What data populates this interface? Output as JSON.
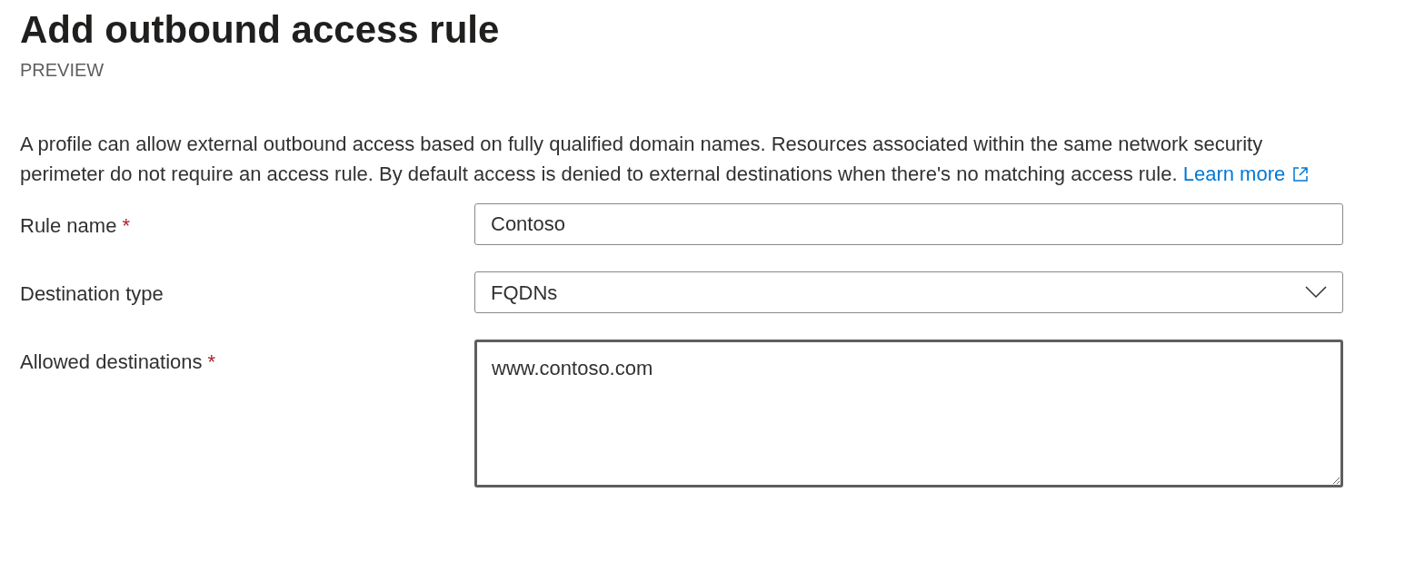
{
  "title": "Add outbound access rule",
  "subtitle": "PREVIEW",
  "description": {
    "text": "A profile can allow external outbound access based on fully qualified domain names. Resources associated within the same network security perimeter do not require an access rule. By default access is denied to external destinations when there's no matching access rule.",
    "link": "Learn more"
  },
  "fields": [
    {
      "kind": "text",
      "label": "Rule name",
      "required_mark": "*",
      "value": "Contoso",
      "focused": false
    },
    {
      "kind": "dropdown",
      "label": "Destination type",
      "value": "FQDNs",
      "focused": false
    },
    {
      "kind": "textarea",
      "label": "Allowed destinations",
      "required_mark": "*",
      "value": "www.contoso.com",
      "focused": true
    }
  ]
}
